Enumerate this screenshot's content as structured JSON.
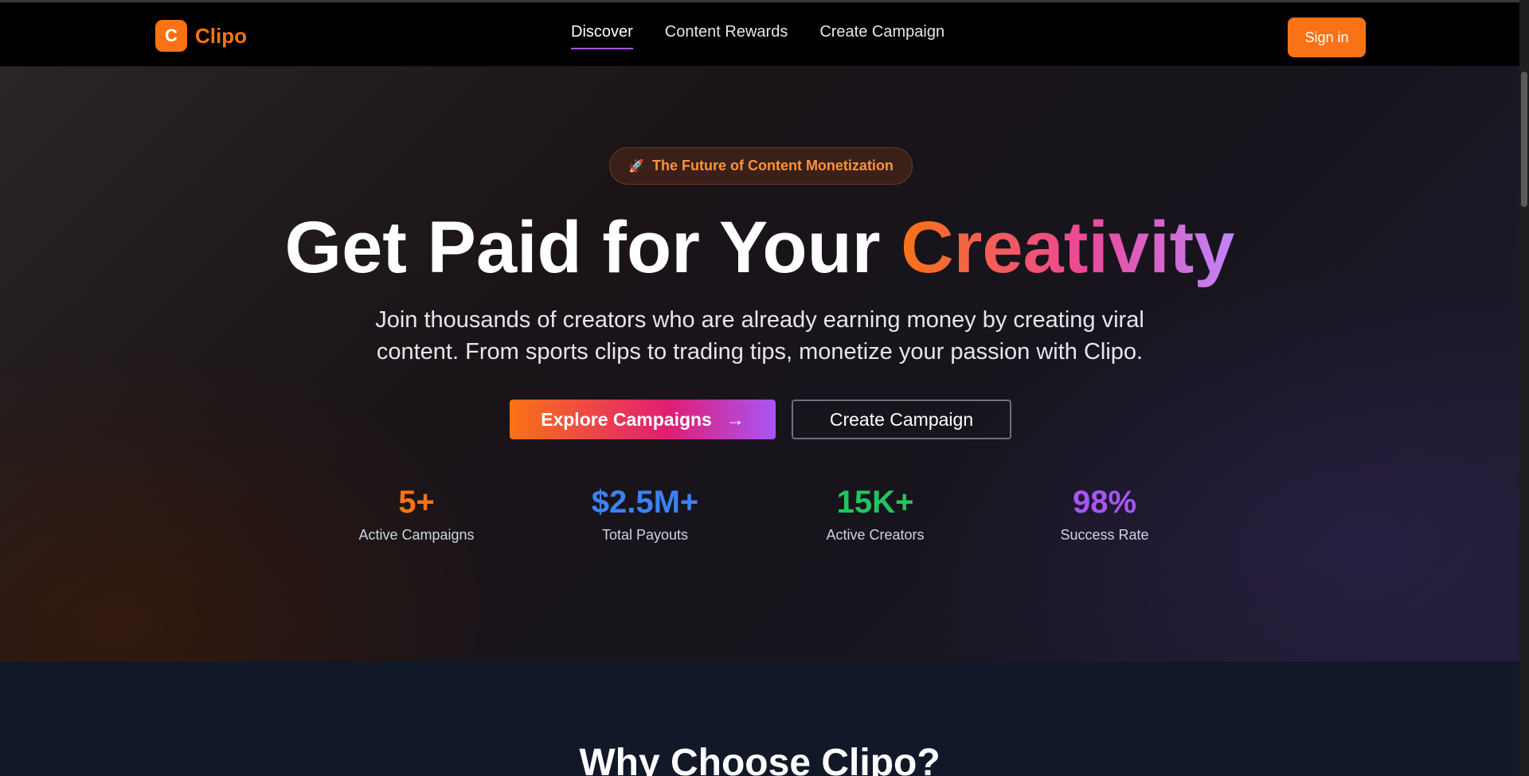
{
  "brand": {
    "mark": "C",
    "name": "Clipo"
  },
  "nav": {
    "items": [
      {
        "label": "Discover",
        "active": true
      },
      {
        "label": "Content Rewards",
        "active": false
      },
      {
        "label": "Create Campaign",
        "active": false
      }
    ],
    "signin_label": "Sign in"
  },
  "hero": {
    "badge_icon": "rocket-icon",
    "badge_emoji": "🚀",
    "badge_text": "The Future of Content Monetization",
    "headline_plain": "Get Paid for Your ",
    "headline_accent": "Creativity",
    "subtitle_line1": "Join thousands of creators who are already earning money by creating viral",
    "subtitle_line2": "content. From sports clips to trading tips, monetize your passion with Clipo.",
    "cta_primary": "Explore Campaigns",
    "cta_primary_icon": "→",
    "cta_secondary": "Create Campaign"
  },
  "stats": [
    {
      "value": "5+",
      "label": "Active Campaigns",
      "color": "#f97316"
    },
    {
      "value": "$2.5M+",
      "label": "Total Payouts",
      "color": "#3b82f6"
    },
    {
      "value": "15K+",
      "label": "Active Creators",
      "color": "#22c55e"
    },
    {
      "value": "98%",
      "label": "Success Rate",
      "color": "#a855f7"
    }
  ],
  "section2": {
    "title": "Why Choose Clipo?"
  },
  "colors": {
    "accent": "#f97316",
    "active_underline": "#a855f7"
  }
}
